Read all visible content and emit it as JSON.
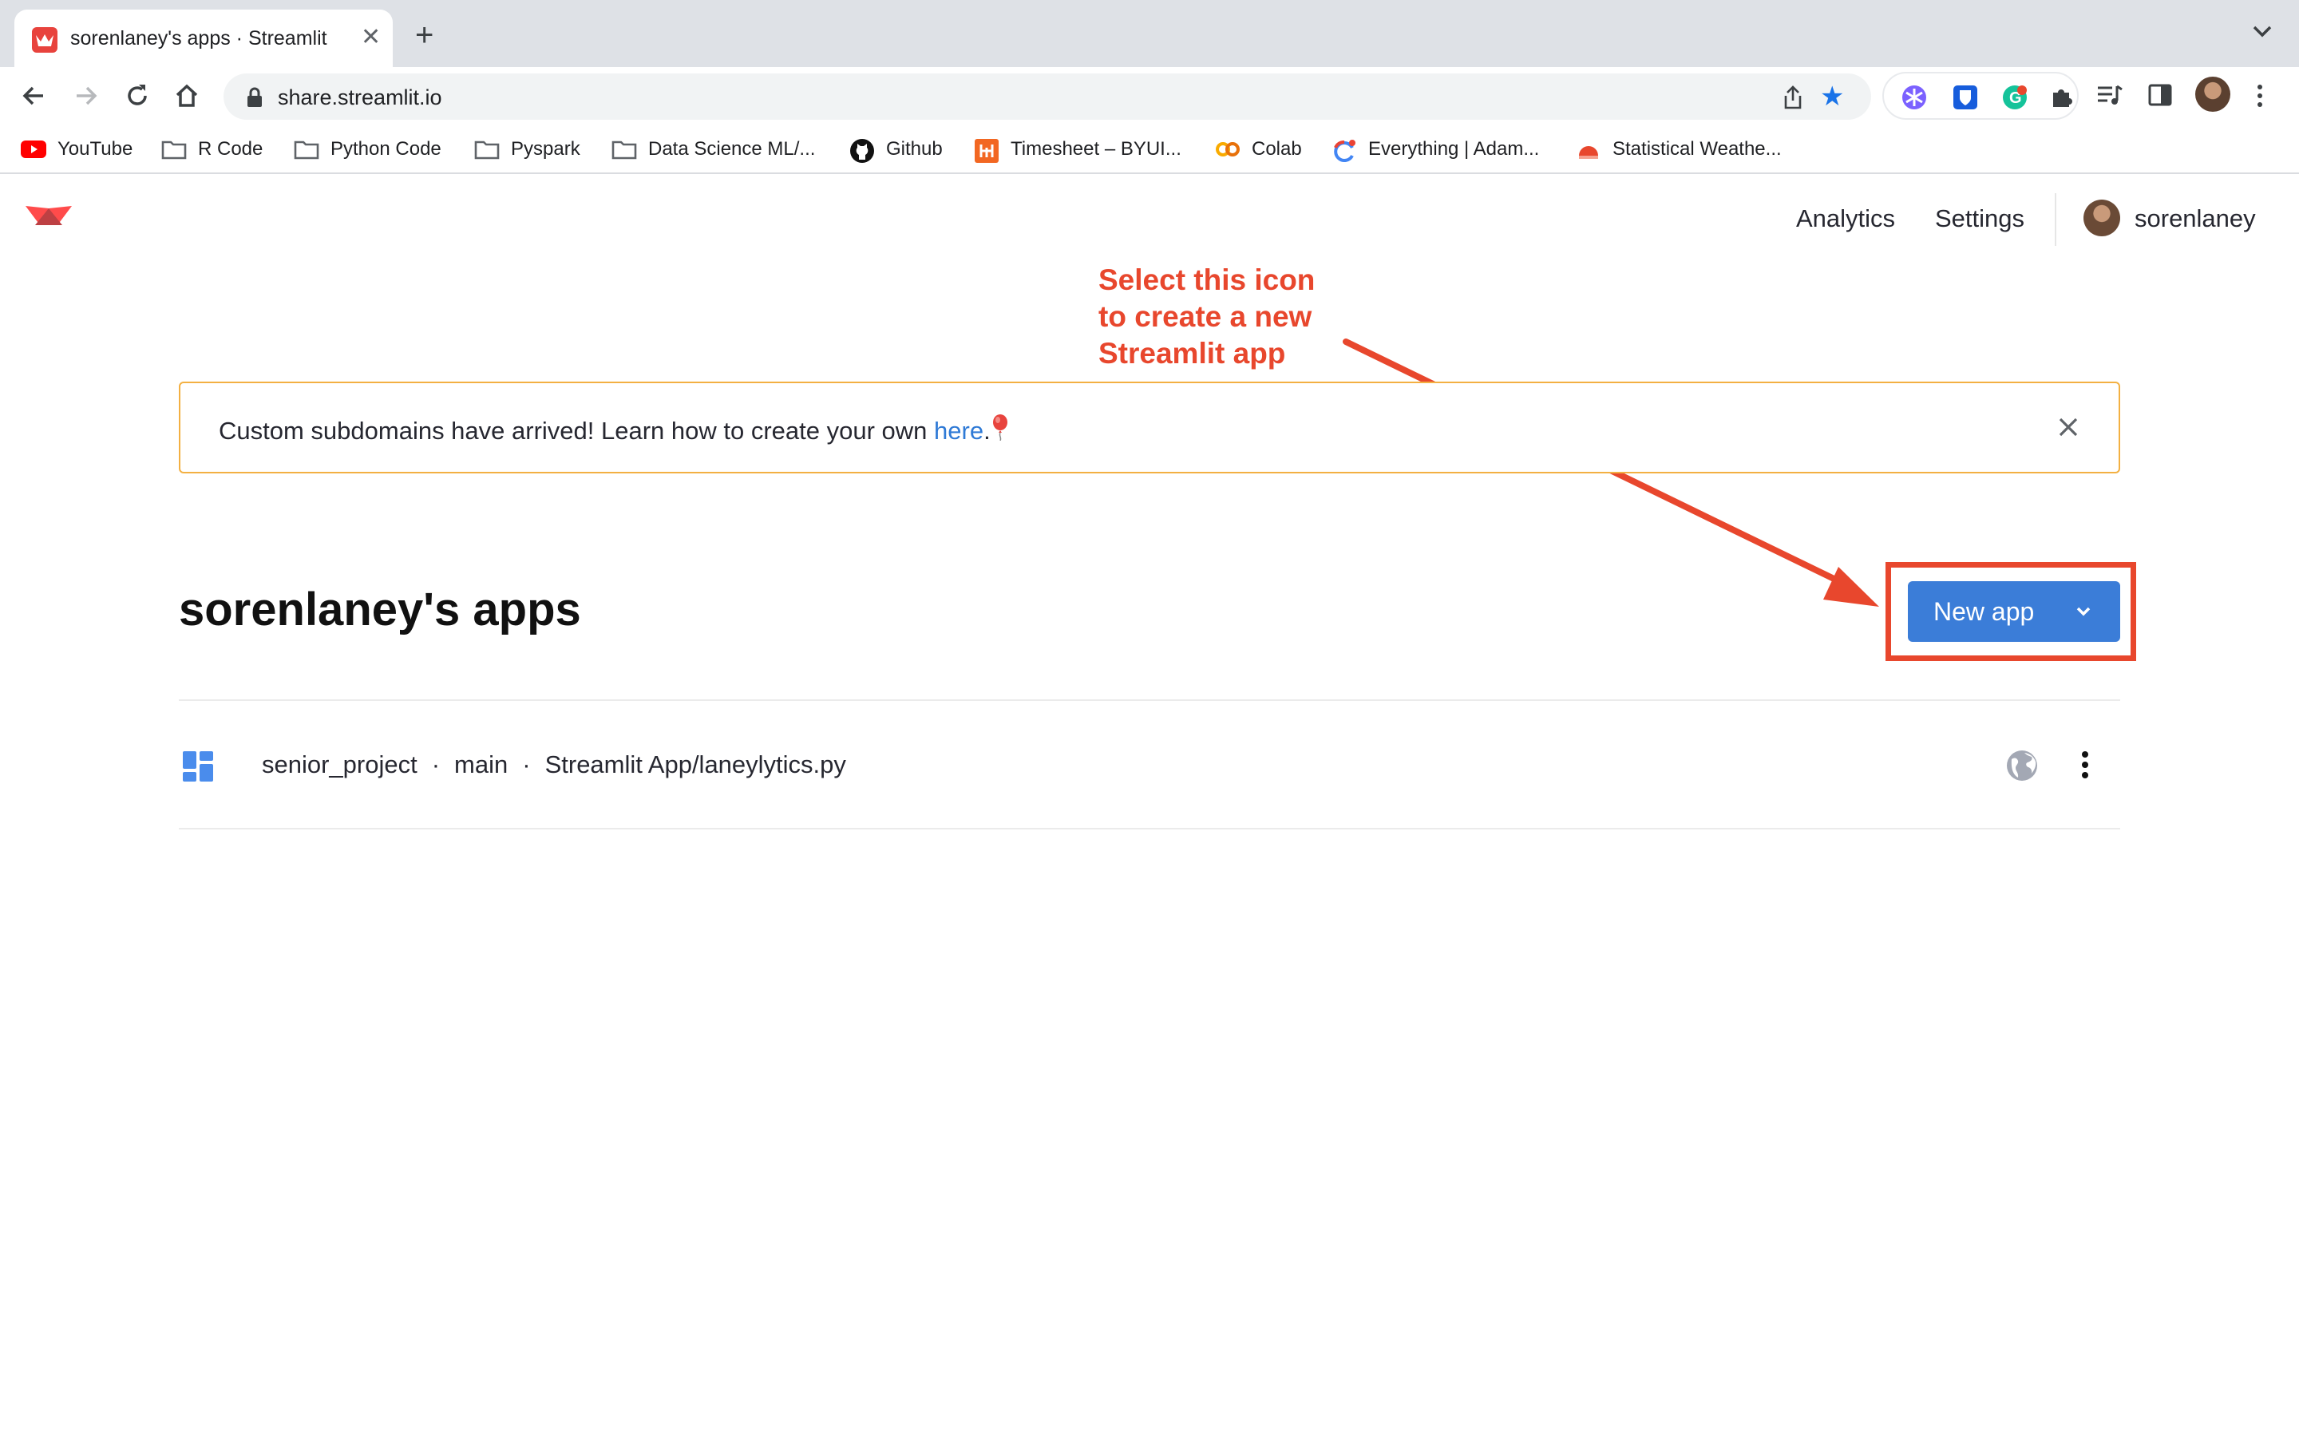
{
  "browser": {
    "tab_title": "sorenlaney's apps · Streamlit",
    "tab_close": "✕",
    "new_tab": "+",
    "url": "share.streamlit.io"
  },
  "bookmarks": [
    {
      "label": "YouTube",
      "icon": "youtube-icon"
    },
    {
      "label": "R Code",
      "icon": "folder-icon"
    },
    {
      "label": "Python Code",
      "icon": "folder-icon"
    },
    {
      "label": "Pyspark",
      "icon": "folder-icon"
    },
    {
      "label": "Data Science ML/...",
      "icon": "folder-icon"
    },
    {
      "label": "Github",
      "icon": "github-icon"
    },
    {
      "label": "Timesheet – BYUI...",
      "icon": "timesheet-icon"
    },
    {
      "label": "Colab",
      "icon": "colab-icon"
    },
    {
      "label": "Everything | Adam...",
      "icon": "google-icon"
    },
    {
      "label": "Statistical Weathe...",
      "icon": "weather-icon"
    }
  ],
  "nav": {
    "analytics": "Analytics",
    "settings": "Settings",
    "username": "sorenlaney"
  },
  "annotation": {
    "line1": "Select this icon",
    "line2": "to create a new",
    "line3": "Streamlit app",
    "color": "#e8472d"
  },
  "banner": {
    "text": "Custom subdomains have arrived! Learn how to create your own ",
    "link": "here",
    "suffix": ".",
    "border_color": "#f3b042"
  },
  "page": {
    "title": "sorenlaney's apps",
    "new_app_label": "New app",
    "accent": "#3b7dd8"
  },
  "apps": [
    {
      "repo": "senior_project",
      "branch": "main",
      "file": "Streamlit App/laneylytics.py",
      "separator": "·"
    }
  ]
}
